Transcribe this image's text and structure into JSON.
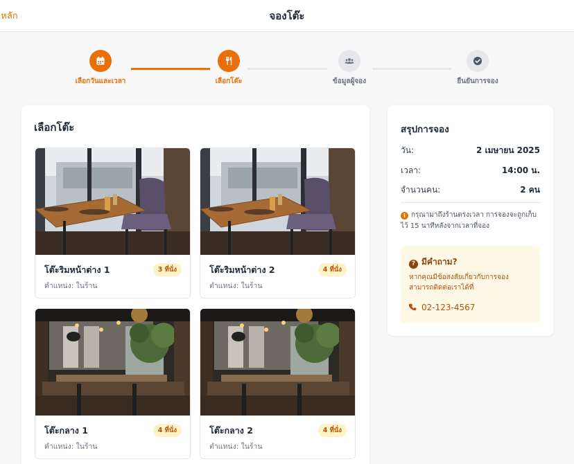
{
  "header": {
    "back_label": "าหลัก",
    "title": "จองโต๊ะ"
  },
  "stepper": {
    "steps": [
      {
        "label": "เลือกวันและเวลา",
        "icon": "calendar-icon",
        "state": "done"
      },
      {
        "label": "เลือกโต๊ะ",
        "icon": "utensils-icon",
        "state": "current"
      },
      {
        "label": "ข้อมูลผู้จอง",
        "icon": "users-icon",
        "state": "pending"
      },
      {
        "label": "ยืนยันการจอง",
        "icon": "check-circle-icon",
        "state": "pending"
      }
    ]
  },
  "tables": {
    "title": "เลือกโต๊ะ",
    "items": [
      {
        "name": "โต๊ะริมหน้าต่าง 1",
        "position": "ตำแหน่ง: ในร้าน",
        "seats": "3 ที่นั่ง",
        "photo": "window-table-photo"
      },
      {
        "name": "โต๊ะริมหน้าต่าง 2",
        "position": "ตำแหน่ง: ในร้าน",
        "seats": "4 ที่นั่ง",
        "photo": "window-table-photo"
      },
      {
        "name": "โต๊ะกลาง 1",
        "position": "ตำแหน่ง: ในร้าน",
        "seats": "4 ที่นั่ง",
        "photo": "restaurant-interior-photo"
      },
      {
        "name": "โต๊ะกลาง 2",
        "position": "ตำแหน่ง: ในร้าน",
        "seats": "4 ที่นั่ง",
        "photo": "restaurant-interior-photo"
      }
    ]
  },
  "summary": {
    "title": "สรุปการจอง",
    "date_label": "วัน:",
    "date_value": "2 เมษายน 2025",
    "time_label": "เวลา:",
    "time_value": "14:00 น.",
    "guests_label": "จำนวนคน:",
    "guests_value": "2 คน",
    "note": "กรุณามาถึงร้านตรงเวลา การจองจะถูกเก็บไว้ 15 นาทีหลังจากเวลาที่จอง"
  },
  "help": {
    "title": "มีคำถาม?",
    "text": "หากคุณมีข้อสงสัยเกี่ยวกับการจอง สามารถติดต่อเราได้ที่",
    "phone": "02-123-4567"
  },
  "colors": {
    "accent": "#e8700b",
    "accent_text": "#d97706",
    "inactive": "#e5e7eb",
    "badge_bg": "#fef3c7",
    "help_bg": "#fef9e6"
  }
}
